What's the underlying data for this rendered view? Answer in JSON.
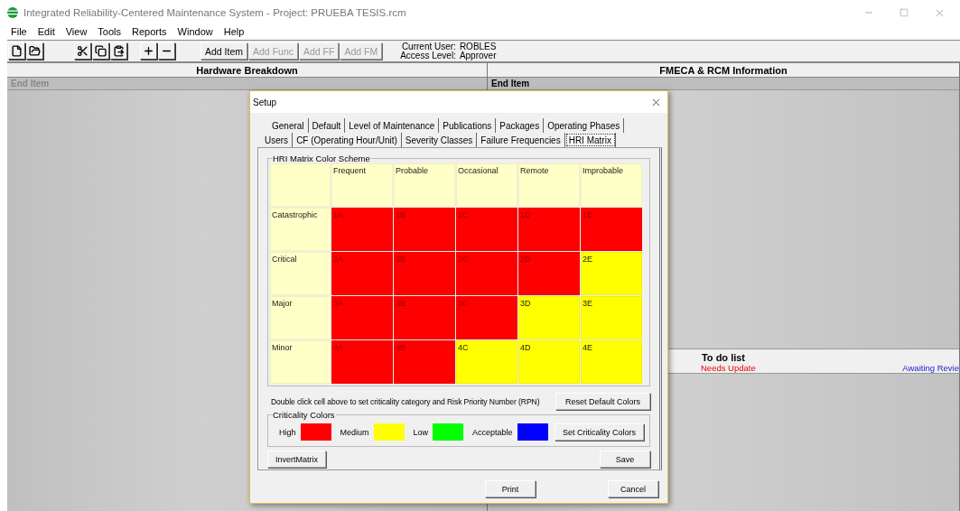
{
  "window": {
    "title": "Integrated Reliability-Centered Maintenance System  -  Project: PRUEBA TESIS.rcm"
  },
  "menu": [
    "File",
    "Edit",
    "View",
    "Tools",
    "Reports",
    "Window",
    "Help"
  ],
  "toolbar": {
    "buttons": [
      {
        "label": "Add Item",
        "disabled": false
      },
      {
        "label": "Add Func",
        "disabled": true
      },
      {
        "label": "Add FF",
        "disabled": true
      },
      {
        "label": "Add FM",
        "disabled": true
      }
    ],
    "user_label": "Current User:",
    "user": "ROBLES",
    "access_label": "Access Level:",
    "access": "Approver"
  },
  "left_pane": {
    "title": "Hardware Breakdown",
    "column": "End Item"
  },
  "right_pane": {
    "title": "FMECA & RCM Information",
    "column": "End Item",
    "todo": {
      "title": "To do list",
      "needs_update": "Needs Update",
      "awaiting_review": "Awaiting Revie"
    }
  },
  "dialog": {
    "title": "Setup",
    "tab_rows": [
      [
        {
          "label": "General",
          "selected": false
        },
        {
          "label": "Default",
          "selected": false
        },
        {
          "label": "Level of Maintenance",
          "selected": false
        },
        {
          "label": "Publications",
          "selected": false
        },
        {
          "label": "Packages",
          "selected": false
        },
        {
          "label": "Operating Phases",
          "selected": false
        }
      ],
      [
        {
          "label": "Users",
          "selected": false
        },
        {
          "label": "CF (Operating Hour/Unit)",
          "selected": false
        },
        {
          "label": "Severity Classes",
          "selected": false
        },
        {
          "label": "Failure Frequencies",
          "selected": false
        },
        {
          "label": "HRI Matrix",
          "selected": true
        }
      ]
    ],
    "matrix_group": "HRI Matrix Color Scheme",
    "columns": [
      "Frequent",
      "Probable",
      "Occasional",
      "Remote",
      "Improbable"
    ],
    "rows": [
      {
        "label": "Catastrophic",
        "cells": [
          {
            "label": "1A",
            "color": "#ff0000"
          },
          {
            "label": "1B",
            "color": "#ff0000"
          },
          {
            "label": "1C",
            "color": "#ff0000"
          },
          {
            "label": "1D",
            "color": "#ff0000"
          },
          {
            "label": "1E",
            "color": "#ff0000"
          }
        ]
      },
      {
        "label": "Critical",
        "cells": [
          {
            "label": "2A",
            "color": "#ff0000"
          },
          {
            "label": "2B",
            "color": "#ff0000"
          },
          {
            "label": "2C",
            "color": "#ff0000"
          },
          {
            "label": "2D",
            "color": "#ff0000"
          },
          {
            "label": "2E",
            "color": "#ffff00"
          }
        ]
      },
      {
        "label": "Major",
        "cells": [
          {
            "label": "3A",
            "color": "#ff0000"
          },
          {
            "label": "3B",
            "color": "#ff0000"
          },
          {
            "label": "3C",
            "color": "#ff0000"
          },
          {
            "label": "3D",
            "color": "#ffff00"
          },
          {
            "label": "3E",
            "color": "#ffff00"
          }
        ]
      },
      {
        "label": "Minor",
        "cells": [
          {
            "label": "4A",
            "color": "#ff0000"
          },
          {
            "label": "4B",
            "color": "#ff0000"
          },
          {
            "label": "4C",
            "color": "#ffff00"
          },
          {
            "label": "4D",
            "color": "#ffff00"
          },
          {
            "label": "4E",
            "color": "#ffff00"
          }
        ]
      }
    ],
    "note": "Double click cell above to set criticality category and Risk Priority Number (RPN)",
    "reset_button": "Reset Default Colors",
    "criticality_group": "Criticality Colors",
    "criticality": [
      {
        "label": "High",
        "color": "#ff0000"
      },
      {
        "label": "Medium",
        "color": "#ffff00"
      },
      {
        "label": "Low",
        "color": "#00ff00"
      },
      {
        "label": "Acceptable",
        "color": "#0000ff"
      }
    ],
    "set_colors_button": "Set Criticality Colors",
    "invert_button": "InvertMatrix",
    "save_button": "Save",
    "print_button": "Print",
    "cancel_button": "Cancel"
  }
}
